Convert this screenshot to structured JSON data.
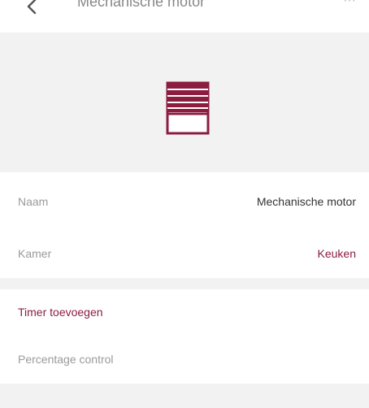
{
  "header": {
    "title": "Mechanische motor",
    "action_label": "···",
    "back_icon": "chevron-left-icon"
  },
  "device": {
    "icon": "roller-shutter-icon",
    "accent_color": "#8c1d40"
  },
  "info": {
    "name_label": "Naam",
    "name_value": "Mechanische motor",
    "room_label": "Kamer",
    "room_value": "Keuken"
  },
  "actions": {
    "timer_label": "Timer toevoegen",
    "percentage_label": "Percentage control"
  }
}
